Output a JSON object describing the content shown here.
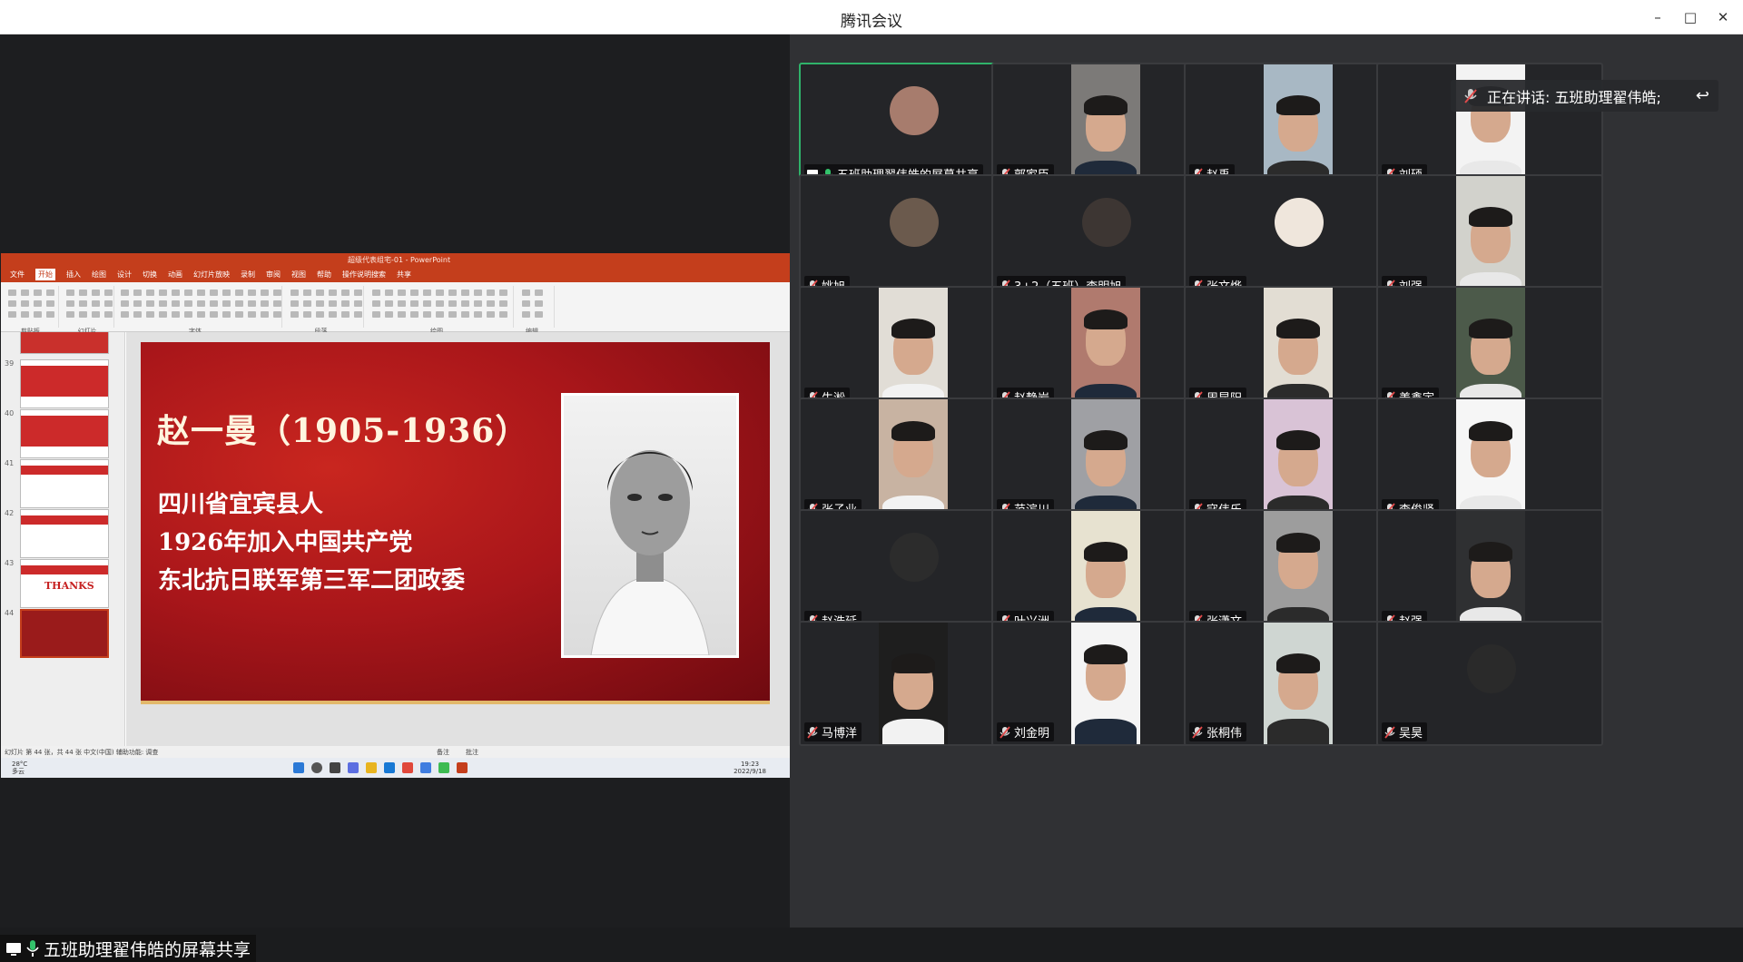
{
  "window": {
    "title": "腾讯会议"
  },
  "ppt": {
    "title": "超级代表组宅-01 - PowerPoint",
    "menu": [
      "文件",
      "开始",
      "插入",
      "绘图",
      "设计",
      "切换",
      "动画",
      "幻灯片放映",
      "录制",
      "审阅",
      "视图",
      "帮助",
      "操作说明搜索",
      "共享"
    ],
    "ribbon_groups": [
      "剪贴板",
      "幻灯片",
      "字体",
      "段落",
      "绘图",
      "编辑"
    ],
    "thumb_numbers": [
      "39",
      "40",
      "41",
      "42",
      "43",
      "44"
    ],
    "thanks_text": "THANKS",
    "status": "幻灯片 第 44 张，共 44 张   中文(中国)   辅助功能: 调查",
    "notes_label": "备注",
    "comments_label": "批注",
    "weather_temp": "28°C",
    "weather_desc": "多云",
    "time": "19:23",
    "date": "2022/9/18"
  },
  "slide": {
    "name": "赵一曼（1905-1936）",
    "lines": [
      "四川省宜宾县人",
      "1926年加入中国共产党",
      "东北抗日联军第三军二团政委"
    ]
  },
  "share_label": "五班助理翟伟皓的屏幕共享",
  "speaking": "正在讲话: 五班助理翟伟皓;",
  "participants": [
    "五班助理翟伟皓的屏幕共享",
    "郭家臣",
    "赵禹",
    "刘硕",
    "姚旭",
    "3+2（五班）李明旭",
    "张文烨",
    "刘强",
    "牛淞",
    "赵静岩",
    "周昆阳",
    "姜鑫宇",
    "张子业",
    "范滨川",
    "寇伟乐",
    "李俊贤",
    "赵浩延",
    "叶兴洲",
    "张潇文",
    "赵强",
    "马博洋",
    "刘金明",
    "张桐伟",
    "吴昊"
  ],
  "colors": {
    "active_border": "#2fb36a",
    "ppt_red": "#c43e1c",
    "muted_mic": "#e04a4a",
    "live_mic": "#33c26b"
  }
}
